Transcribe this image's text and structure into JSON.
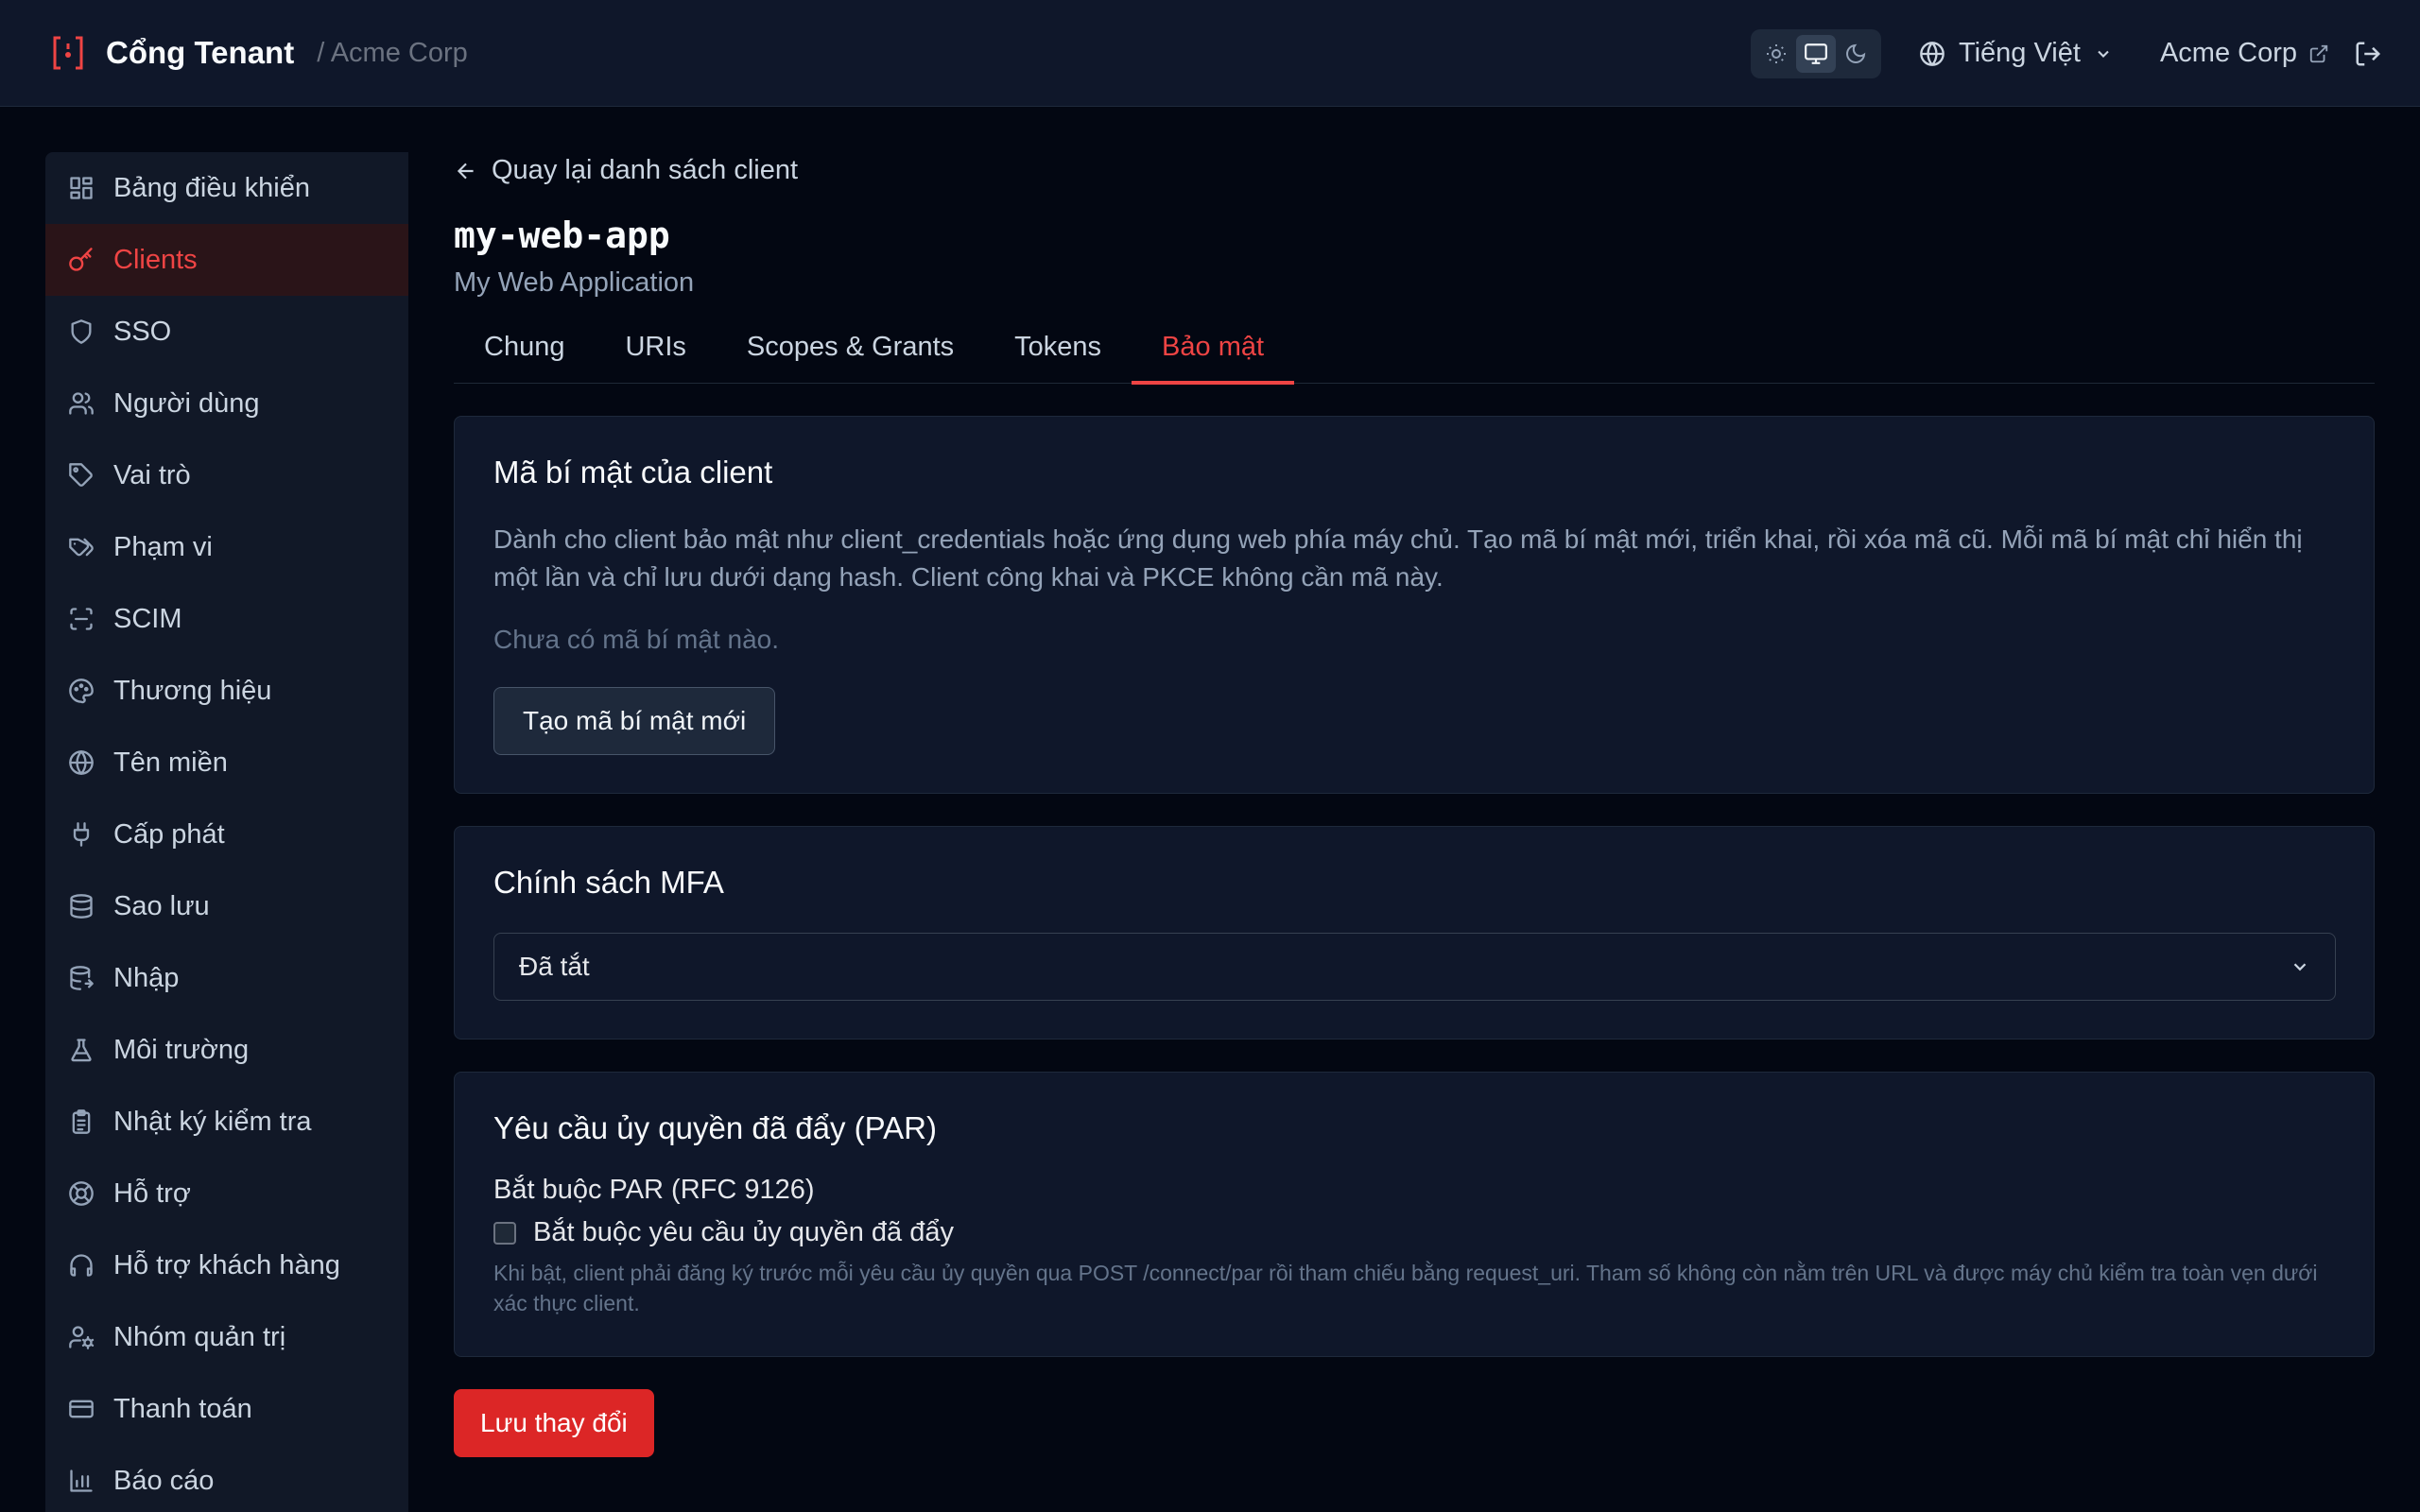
{
  "header": {
    "brand_title": "Cổng Tenant",
    "breadcrumb": "/ Acme Corp",
    "theme_options": [
      "light",
      "system",
      "dark"
    ],
    "theme_selected": "system",
    "language": "Tiếng Việt",
    "org_link": "Acme Corp"
  },
  "sidebar": {
    "items": [
      {
        "label": "Bảng điều khiển",
        "icon": "dashboard-icon"
      },
      {
        "label": "Clients",
        "icon": "key-icon",
        "active": true
      },
      {
        "label": "SSO",
        "icon": "shield-icon"
      },
      {
        "label": "Người dùng",
        "icon": "users-icon"
      },
      {
        "label": "Vai trò",
        "icon": "tag-icon"
      },
      {
        "label": "Phạm vi",
        "icon": "tags-icon"
      },
      {
        "label": "SCIM",
        "icon": "scan-icon"
      },
      {
        "label": "Thương hiệu",
        "icon": "palette-icon"
      },
      {
        "label": "Tên miền",
        "icon": "globe-icon"
      },
      {
        "label": "Cấp phát",
        "icon": "plug-icon"
      },
      {
        "label": "Sao lưu",
        "icon": "database-icon"
      },
      {
        "label": "Nhập",
        "icon": "database-import-icon"
      },
      {
        "label": "Môi trường",
        "icon": "flask-icon"
      },
      {
        "label": "Nhật ký kiểm tra",
        "icon": "clipboard-icon"
      },
      {
        "label": "Hỗ trợ",
        "icon": "lifebuoy-icon"
      },
      {
        "label": "Hỗ trợ khách hàng",
        "icon": "headphones-icon"
      },
      {
        "label": "Nhóm quản trị",
        "icon": "user-cog-icon"
      },
      {
        "label": "Thanh toán",
        "icon": "credit-card-icon"
      },
      {
        "label": "Báo cáo",
        "icon": "bar-chart-icon"
      }
    ]
  },
  "main": {
    "back_link": "Quay lại danh sách client",
    "client_id": "my-web-app",
    "client_name": "My Web Application",
    "tabs": [
      "Chung",
      "URIs",
      "Scopes & Grants",
      "Tokens",
      "Bảo mật"
    ],
    "active_tab": "Bảo mật",
    "secrets": {
      "title": "Mã bí mật của client",
      "description": "Dành cho client bảo mật như client_credentials hoặc ứng dụng web phía máy chủ. Tạo mã bí mật mới, triển khai, rồi xóa mã cũ. Mỗi mã bí mật chỉ hiển thị một lần và chỉ lưu dưới dạng hash. Client công khai và PKCE không cần mã này.",
      "empty_text": "Chưa có mã bí mật nào.",
      "create_button": "Tạo mã bí mật mới"
    },
    "mfa": {
      "title": "Chính sách MFA",
      "selected": "Đã tắt"
    },
    "par": {
      "title": "Yêu cầu ủy quyền đã đẩy (PAR)",
      "field_label": "Bắt buộc PAR (RFC 9126)",
      "checkbox_label": "Bắt buộc yêu cầu ủy quyền đã đẩy",
      "checked": false,
      "help": "Khi bật, client phải đăng ký trước mỗi yêu cầu ủy quyền qua POST /connect/par rồi tham chiếu bằng request_uri. Tham số không còn nằm trên URL và được máy chủ kiểm tra toàn vẹn dưới xác thực client."
    },
    "save_button": "Lưu thay đổi"
  },
  "colors": {
    "accent": "#ef4444",
    "primary_button": "#dc2626",
    "background": "#030712",
    "surface": "#0f172a"
  }
}
